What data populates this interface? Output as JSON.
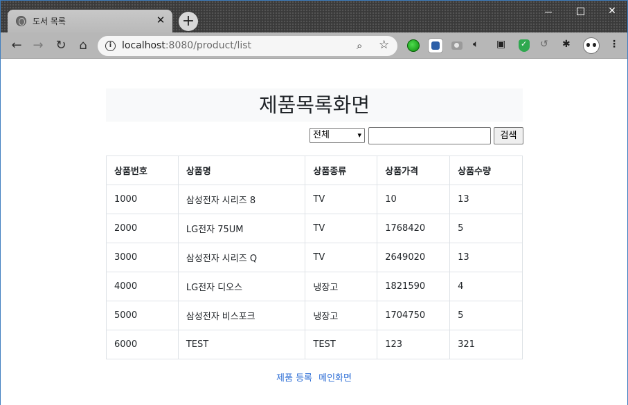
{
  "browser": {
    "tab_title": "도서 목록",
    "tab_close": "✕",
    "new_tab": "+",
    "url_host": "localhost",
    "url_rest": ":8080/product/list",
    "window_controls": {
      "minimize": "",
      "maximize": "",
      "close": "✕"
    },
    "nav": {
      "back": "←",
      "forward": "→",
      "reload": "↻",
      "home": "⌂"
    },
    "icons": {
      "info": "i",
      "zoom": "⌕",
      "star": "☆",
      "mute": "🔈︎",
      "pip": "▣",
      "history": "↺",
      "puzzle": "✱",
      "menu": "⋮"
    }
  },
  "page": {
    "heading": "제품목록화면",
    "search": {
      "selected_option": "전체",
      "caret": "▾",
      "input_value": "",
      "button_label": "검색"
    },
    "table": {
      "headers": [
        "상품번호",
        "상품명",
        "상품종류",
        "상품가격",
        "상품수량"
      ],
      "rows": [
        [
          "1000",
          "삼성전자 시리즈 8",
          "TV",
          "10",
          "13"
        ],
        [
          "2000",
          "LG전자 75UM",
          "TV",
          "1768420",
          "5"
        ],
        [
          "3000",
          "삼성전자 시리즈 Q",
          "TV",
          "2649020",
          "13"
        ],
        [
          "4000",
          "LG전자 디오스",
          "냉장고",
          "1821590",
          "4"
        ],
        [
          "5000",
          "삼성전자 비스포크",
          "냉장고",
          "1704750",
          "5"
        ],
        [
          "6000",
          "TEST",
          "TEST",
          "123",
          "321"
        ]
      ]
    },
    "links": {
      "register": "제품 등록",
      "main": "메인화면"
    }
  },
  "colors": {
    "link": "#2f6fd6",
    "heading_bg": "#f8f9fa",
    "table_border": "#dee2e6",
    "window_border": "#3f7fc0"
  }
}
